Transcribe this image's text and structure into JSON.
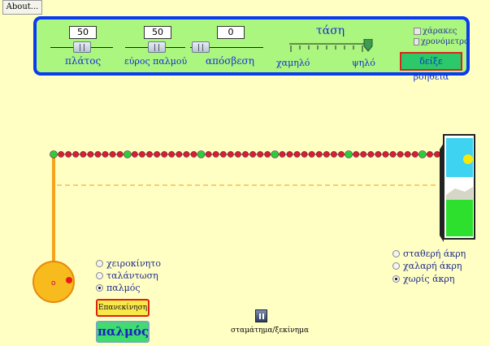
{
  "about_label": "About...",
  "controls": {
    "amplitude": {
      "value": "50",
      "label": "πλάτος"
    },
    "pulse_width": {
      "value": "50",
      "label": "εύρος παλμού"
    },
    "damping": {
      "value": "0",
      "label": "απόσβεση"
    },
    "tension": {
      "title": "τάση",
      "low_label": "χαμηλό",
      "high_label": "ψηλό"
    },
    "checkboxes": [
      {
        "label": "χάρακες",
        "checked": false
      },
      {
        "label": "χρονόμετρο",
        "checked": false
      }
    ],
    "help_label": "δείξε βοήθεια"
  },
  "mode_options": [
    {
      "label": "χειροκίνητο",
      "selected": false
    },
    {
      "label": "ταλάντωση",
      "selected": false
    },
    {
      "label": "παλμός",
      "selected": true
    }
  ],
  "end_options": [
    {
      "label": "σταθερή άκρη",
      "selected": false
    },
    {
      "label": "χαλαρή άκρη",
      "selected": false
    },
    {
      "label": "χωρίς άκρη",
      "selected": true
    }
  ],
  "restart_label": "Επανεκίνηση",
  "pulse_label": "παλμός",
  "pause_label": "σταμάτημα/ξεκίνημα",
  "colors": {
    "background": "#ffffc4",
    "panel": "#aaf67f",
    "panel_border": "#0a3bf0",
    "bead": "#d8202a",
    "bead_marker": "#2ecc3a",
    "wrench": "#f7a21a"
  }
}
